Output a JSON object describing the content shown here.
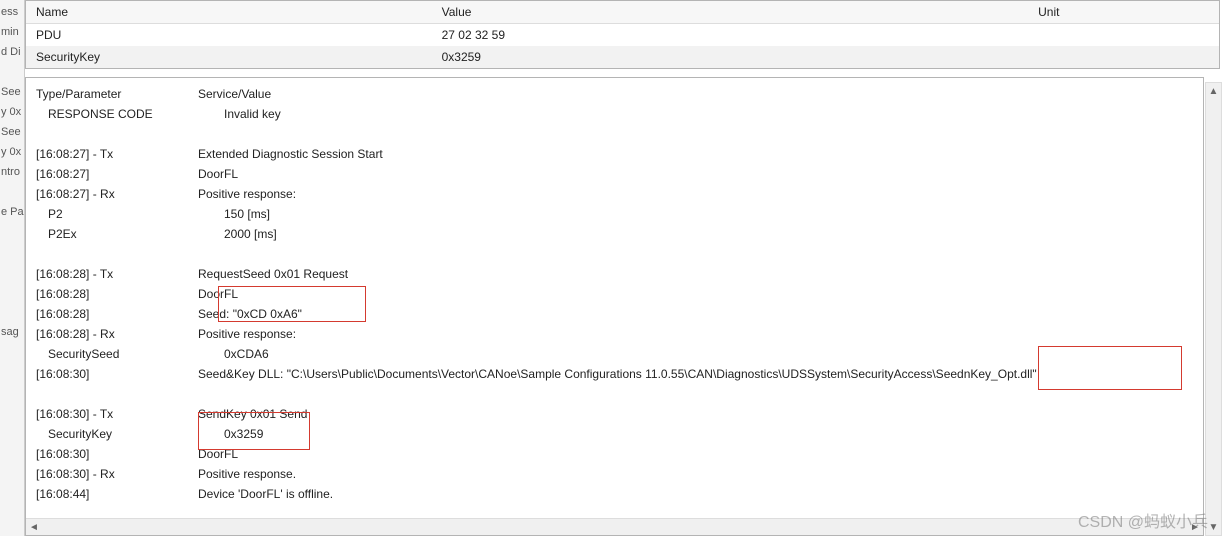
{
  "top_grid": {
    "headers": {
      "name": "Name",
      "value": "Value",
      "unit": "Unit"
    },
    "rows": [
      {
        "name": "PDU",
        "value": "27 02 32 59",
        "unit": ""
      },
      {
        "name": "SecurityKey",
        "value": "0x3259",
        "unit": ""
      }
    ]
  },
  "trace": {
    "header": {
      "left": "Type/Parameter",
      "right": "Service/Value"
    },
    "rows": [
      {
        "left": "RESPONSE CODE",
        "left_indent": true,
        "right": "Invalid key",
        "right_indent": true
      },
      {
        "spacer": true
      },
      {
        "left": "[16:08:27] - Tx",
        "right": "Extended Diagnostic Session Start"
      },
      {
        "left": "[16:08:27]",
        "right": "DoorFL"
      },
      {
        "left": "[16:08:27] - Rx",
        "right": "Positive response:"
      },
      {
        "left": "P2",
        "left_indent": true,
        "right": "150 [ms]",
        "right_indent": true
      },
      {
        "left": "P2Ex",
        "left_indent": true,
        "right": "2000 [ms]",
        "right_indent": true
      },
      {
        "spacer": true
      },
      {
        "left": "[16:08:28] - Tx",
        "right": "RequestSeed 0x01 Request"
      },
      {
        "left": "[16:08:28]",
        "right": "DoorFL"
      },
      {
        "left": "[16:08:28]",
        "right": "Seed: \"0xCD 0xA6\""
      },
      {
        "left": "[16:08:28] - Rx",
        "right": "Positive response:"
      },
      {
        "left": "SecuritySeed",
        "left_indent": true,
        "right": "0xCDA6",
        "right_indent": true
      },
      {
        "left": "[16:08:30]",
        "right": "Seed&Key DLL: \"C:\\Users\\Public\\Documents\\Vector\\CANoe\\Sample Configurations 11.0.55\\CAN\\Diagnostics\\UDSSystem\\SecurityAccess\\SeednKey_Opt.dll\""
      },
      {
        "spacer": true
      },
      {
        "left": "[16:08:30] - Tx",
        "right": "SendKey 0x01 Send"
      },
      {
        "left": "SecurityKey",
        "left_indent": true,
        "right": "0x3259",
        "right_indent": true
      },
      {
        "left": "[16:08:30]",
        "right": "DoorFL"
      },
      {
        "left": "[16:08:30] - Rx",
        "right": "Positive response."
      },
      {
        "left": "[16:08:44]",
        "right": "Device 'DoorFL' is offline."
      }
    ]
  },
  "side_fragments": [
    "ess",
    "min",
    "d Di",
    "",
    "See",
    "y 0x",
    "See",
    "y 0x",
    "ntro",
    "",
    "e Pa",
    "",
    "",
    "",
    "",
    "",
    "sag"
  ],
  "watermark": "CSDN @蚂蚁小兵"
}
